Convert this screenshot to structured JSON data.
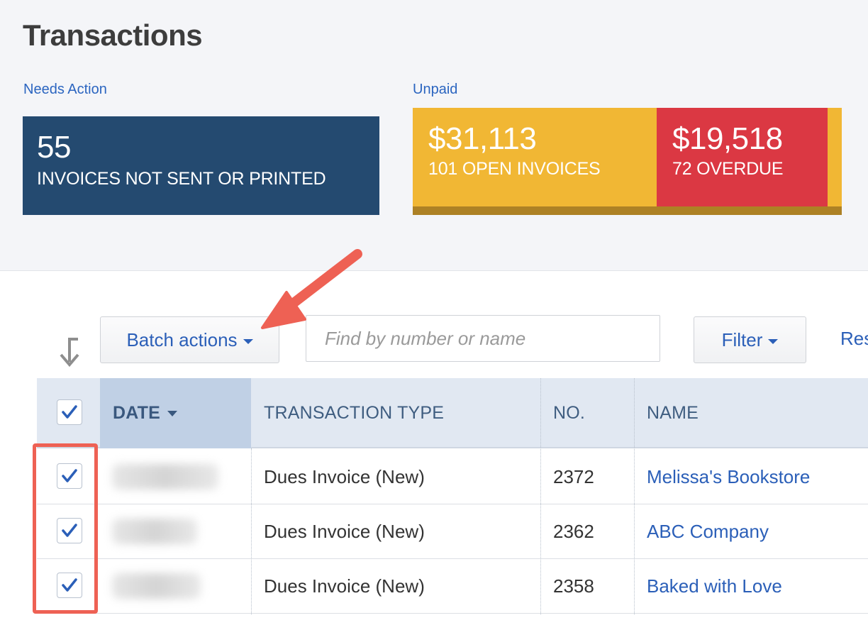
{
  "page": {
    "title": "Transactions"
  },
  "summary": {
    "needs_action": {
      "label": "Needs Action",
      "count": "55",
      "caption": "INVOICES NOT SENT OR PRINTED",
      "color": "#244a70"
    },
    "unpaid": {
      "label": "Unpaid",
      "open": {
        "amount": "$31,113",
        "caption": "101 OPEN INVOICES",
        "color": "#f1b734"
      },
      "overdue": {
        "amount": "$19,518",
        "caption": "72 OVERDUE",
        "color": "#db3843"
      }
    }
  },
  "toolbar": {
    "sort_icon": "arrow-down-icon",
    "batch_label": "Batch actions",
    "search_placeholder": "Find by number or name",
    "filter_label": "Filter",
    "reset_label": "Res"
  },
  "table": {
    "header_checkbox_checked": true,
    "columns": [
      {
        "label": "DATE"
      },
      {
        "label": "TRANSACTION TYPE"
      },
      {
        "label": "NO."
      },
      {
        "label": "NAME"
      }
    ],
    "rows": [
      {
        "checked": true,
        "type": "Dues Invoice (New)",
        "no": "2372",
        "name": "Melissa's Bookstore"
      },
      {
        "checked": true,
        "type": "Dues Invoice (New)",
        "no": "2362",
        "name": "ABC Company"
      },
      {
        "checked": true,
        "type": "Dues Invoice (New)",
        "no": "2358",
        "name": "Baked with Love"
      }
    ]
  },
  "annotation": {
    "highlight_color": "#ee6154"
  }
}
